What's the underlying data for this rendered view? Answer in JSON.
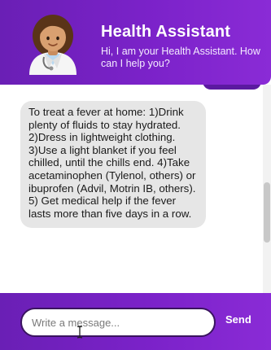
{
  "header": {
    "title": "Health Assistant",
    "subtitle": "Hi, I am your Health Assistant. How can I help you?",
    "avatar_icon": "doctor-avatar-icon"
  },
  "chat": {
    "messages": [
      {
        "sender": "bot",
        "text": "To treat a fever at home: 1)Drink plenty of fluids to stay hydrated. 2)Dress in lightweight clothing. 3)Use a light blanket if you feel chilled, until the chills end. 4)Take acetaminophen (Tylenol, others) or ibuprofen (Advil, Motrin IB, others). 5) Get medical help if the fever lasts more than five days in a row."
      }
    ]
  },
  "composer": {
    "placeholder": "Write a message...",
    "value": "",
    "send_label": "Send"
  },
  "colors": {
    "accent": "#7b22c9",
    "bubble_bg": "#e6e6e6",
    "user_bubble": "#5b1aa0"
  }
}
